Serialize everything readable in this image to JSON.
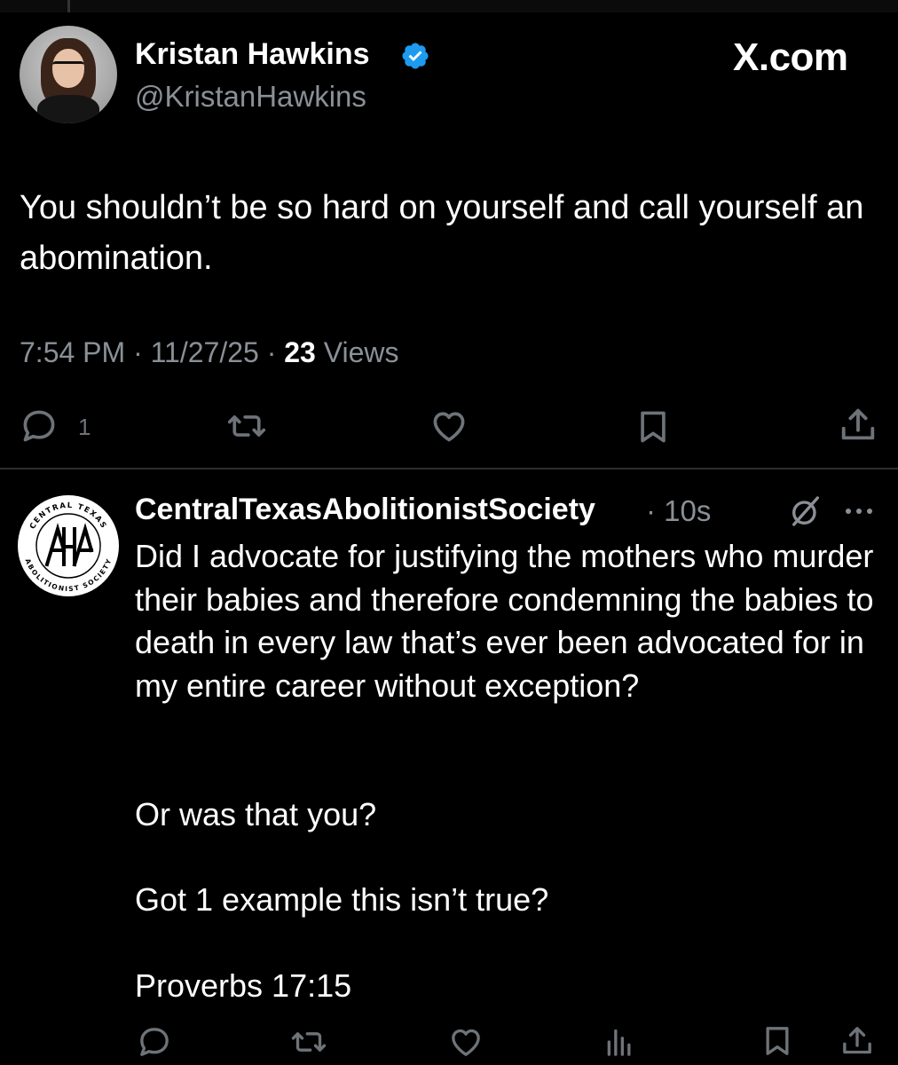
{
  "brand": "X.com",
  "tweet": {
    "author_name": "Kristan Hawkins",
    "author_handle": "@KristanHawkins",
    "verified": true,
    "text": "You shouldn’t be so hard on yourself and call yourself an abomination.",
    "time": "7:54 PM",
    "date": "11/27/25",
    "views_count": "23",
    "views_label": "Views",
    "reply_count": "1",
    "icons": [
      "reply-icon",
      "retweet-icon",
      "like-icon",
      "bookmark-icon",
      "share-icon"
    ]
  },
  "reply": {
    "author_name": "CentralTexasAbolitionistSociety",
    "time": "10s",
    "avatar_text_top": "CENTRAL TEXAS",
    "avatar_text_bottom": "ABOLITIONIST SOCIETY",
    "avatar_monogram": "AHA",
    "paragraphs": [
      "Did I advocate for justifying the mothers who murder their babies and therefore condemning the babies to death in every law that’s ever been advocated for in my entire career without exception?",
      "Or was that you?",
      "Got 1 example this isn’t true?",
      "Proverbs 17:15"
    ],
    "icons": [
      "grok-icon",
      "more-icon",
      "reply-icon",
      "retweet-icon",
      "like-icon",
      "analytics-icon",
      "bookmark-icon",
      "share-icon"
    ]
  },
  "colors": {
    "background": "#000000",
    "text": "#ffffff",
    "secondary": "#8b9097",
    "verified": "#1d9bf0",
    "divider": "#2a2d31"
  }
}
